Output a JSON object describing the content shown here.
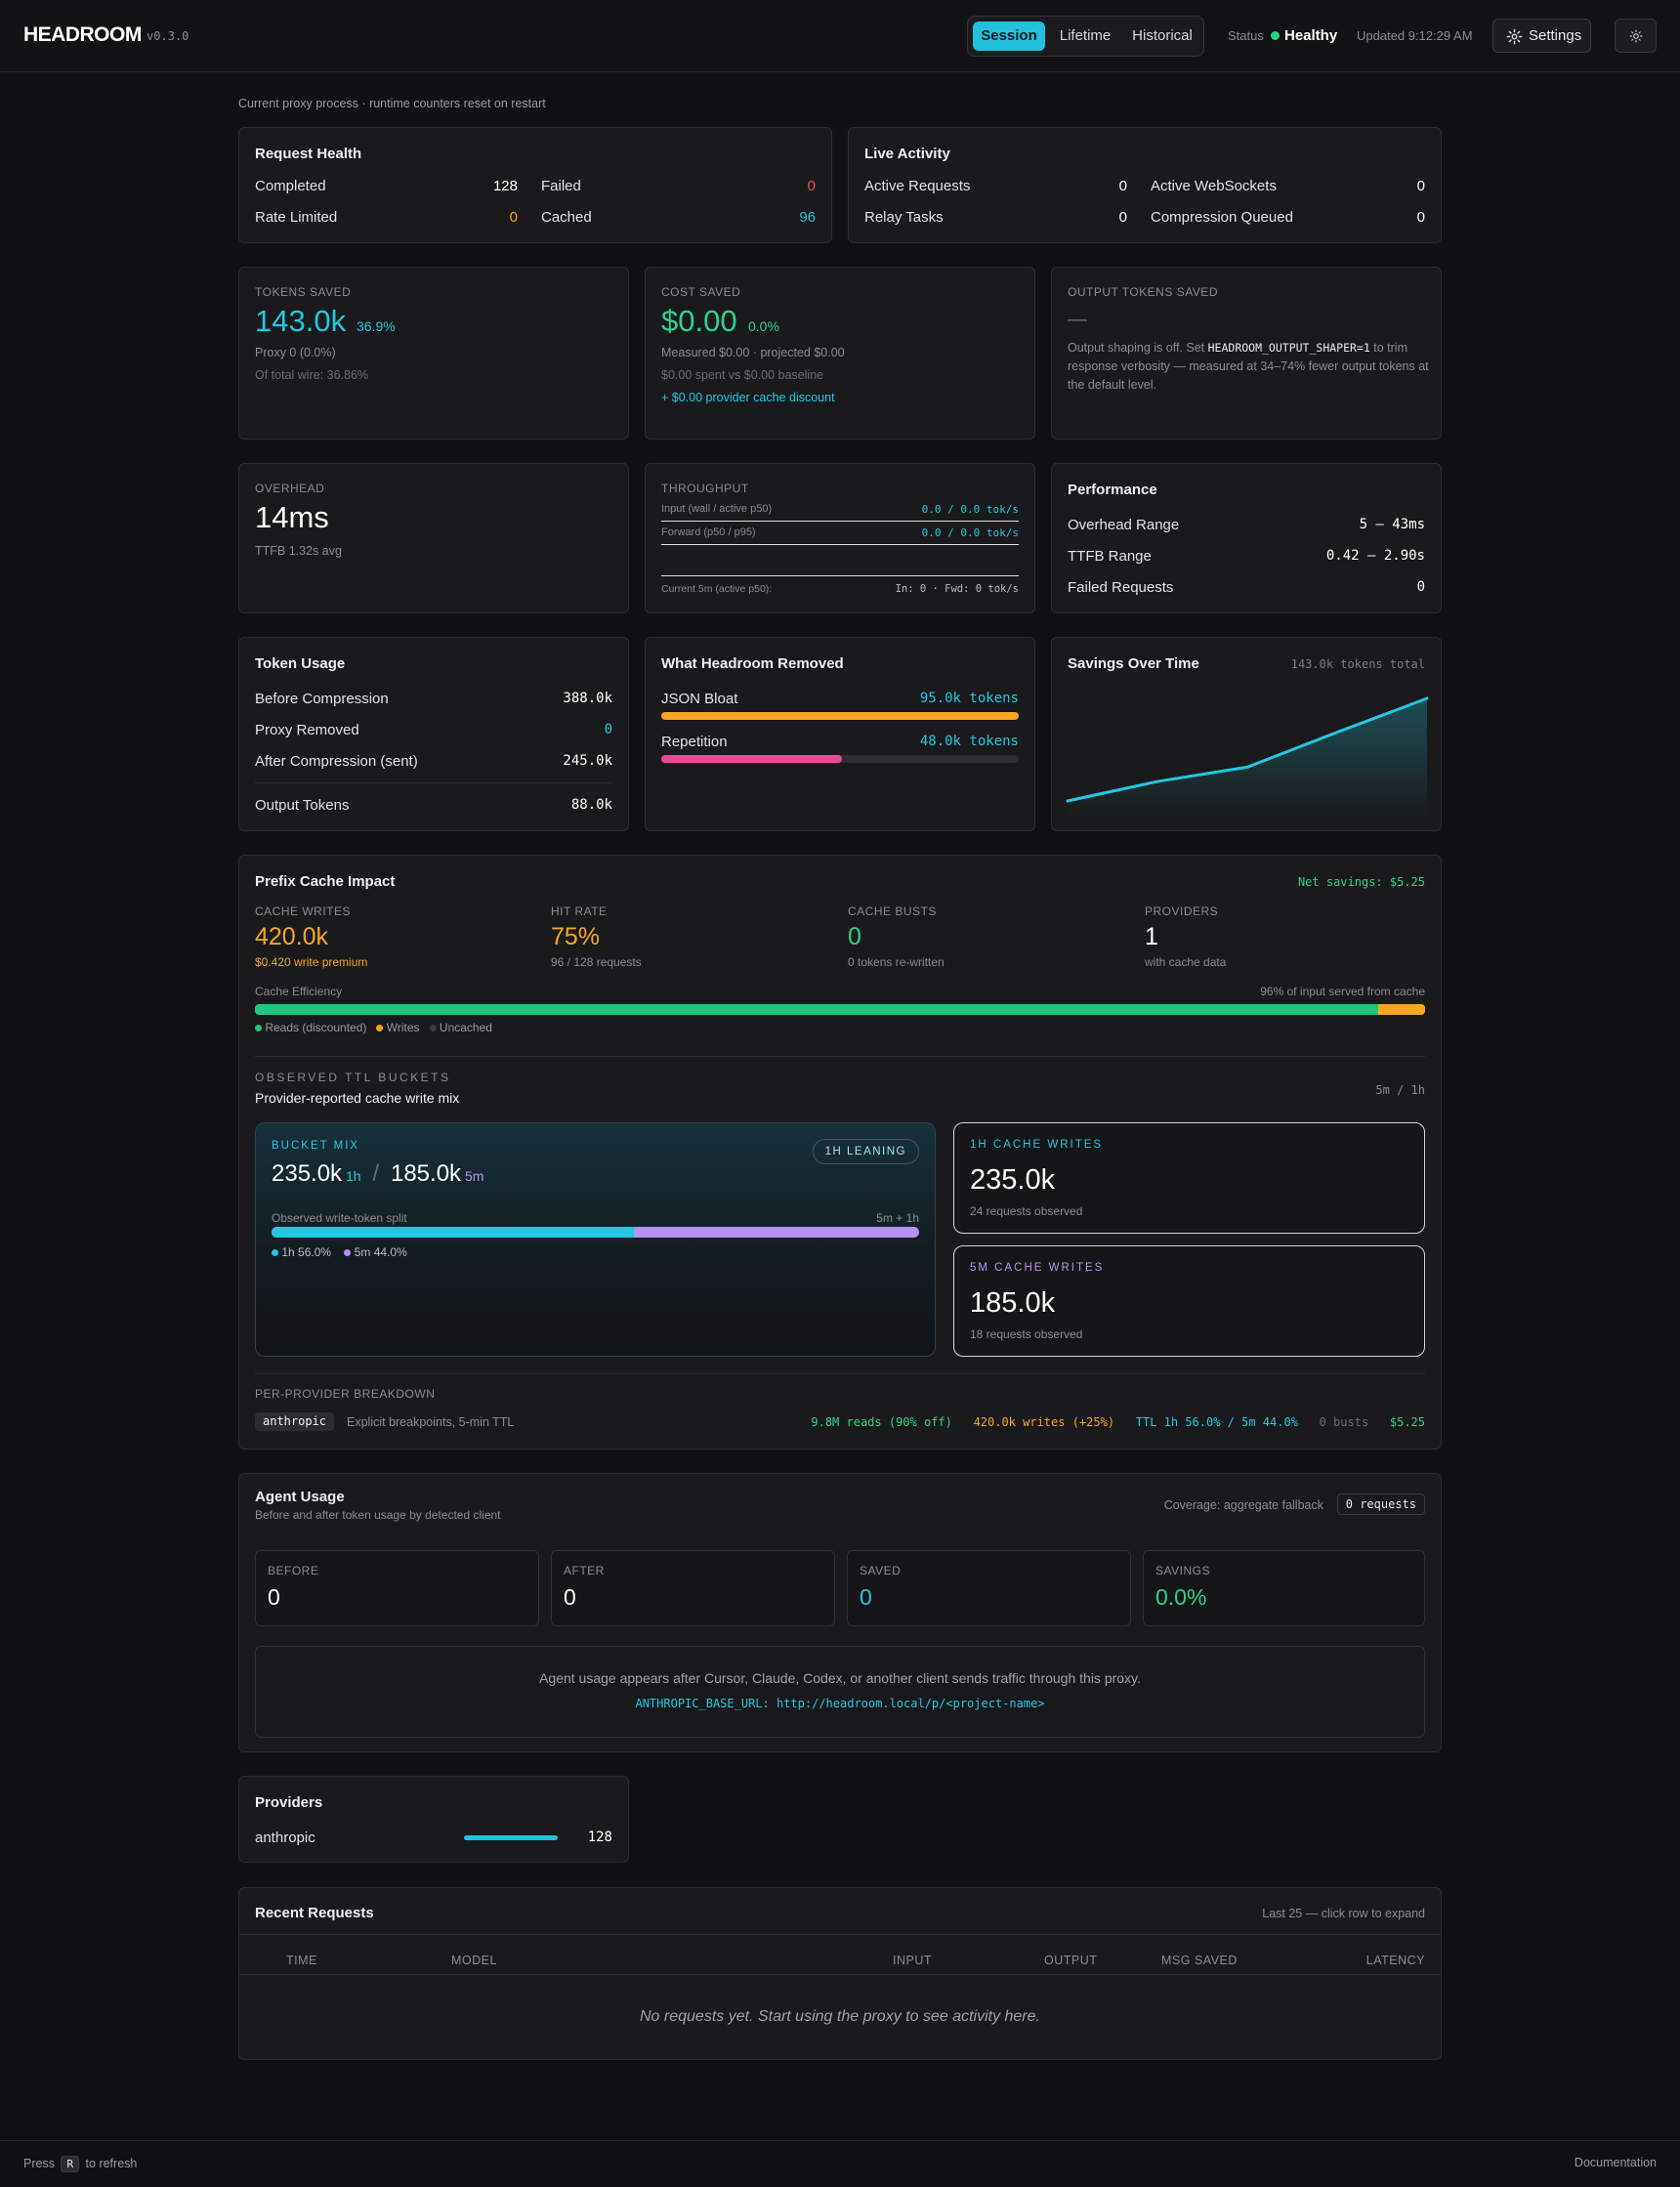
{
  "header": {
    "logo": "HEADROOM",
    "version": "v0.3.0",
    "tabs": [
      "Session",
      "Lifetime",
      "Historical"
    ],
    "active_tab": "Session",
    "status_label": "Status",
    "status_value": "Healthy",
    "updated": "Updated 9:12:29 AM",
    "settings_label": "Settings"
  },
  "subtitle": "Current proxy process · runtime counters reset on restart",
  "request_health": {
    "title": "Request Health",
    "completed_label": "Completed",
    "completed": "128",
    "failed_label": "Failed",
    "failed": "0",
    "rate_limited_label": "Rate Limited",
    "rate_limited": "0",
    "cached_label": "Cached",
    "cached": "96"
  },
  "live_activity": {
    "title": "Live Activity",
    "active_requests_label": "Active Requests",
    "active_requests": "0",
    "active_ws_label": "Active WebSockets",
    "active_ws": "0",
    "relay_label": "Relay Tasks",
    "relay": "0",
    "compression_label": "Compression Queued",
    "compression": "0"
  },
  "tokens_saved": {
    "label": "TOKENS SAVED",
    "value": "143.0k",
    "pct": "36.9%",
    "proxy": "Proxy 0 (0.0%)",
    "wire": "Of total wire: 36.86%"
  },
  "cost_saved": {
    "label": "COST SAVED",
    "value": "$0.00",
    "pct": "0.0%",
    "measured": "Measured $0.00 · projected $0.00",
    "spent": "$0.00 spent vs $0.00 baseline",
    "discount": "+ $0.00 provider cache discount"
  },
  "output_tokens": {
    "label": "OUTPUT TOKENS SAVED",
    "dash": "—",
    "text_pre": "Output shaping is off. Set ",
    "code": "HEADROOM_OUTPUT_SHAPER=1",
    "text_post": " to trim response verbosity — measured at 34–74% fewer output tokens at the default level."
  },
  "overhead": {
    "label": "OVERHEAD",
    "value": "14ms",
    "sub": "TTFB 1.32s avg"
  },
  "throughput": {
    "label": "THROUGHPUT",
    "input_label": "Input (wall / active p50)",
    "input_val": "0.0 / 0.0 tok/s",
    "forward_label": "Forward (p50 / p95)",
    "forward_val": "0.0 / 0.0 tok/s",
    "current_label": "Current 5m (active p50):",
    "current_val": "In: 0 · Fwd: 0 tok/s"
  },
  "performance": {
    "title": "Performance",
    "overhead_label": "Overhead Range",
    "overhead": "5 – 43ms",
    "ttfb_label": "TTFB Range",
    "ttfb": "0.42 – 2.90s",
    "failed_label": "Failed Requests",
    "failed": "0"
  },
  "token_usage": {
    "title": "Token Usage",
    "before_label": "Before Compression",
    "before": "388.0k",
    "proxy_label": "Proxy Removed",
    "proxy": "0",
    "after_label": "After Compression (sent)",
    "after": "245.0k",
    "output_label": "Output Tokens",
    "output": "88.0k"
  },
  "removed": {
    "title": "What Headroom Removed",
    "items": [
      {
        "label": "JSON Bloat",
        "value": "95.0k tokens",
        "fraction": 1.0,
        "color": "#f5a623"
      },
      {
        "label": "Repetition",
        "value": "48.0k tokens",
        "fraction": 0.505,
        "color": "#ec4899"
      }
    ]
  },
  "savings_chart": {
    "title": "Savings Over Time",
    "total": "143.0k tokens total"
  },
  "chart_data": {
    "type": "area",
    "series": [
      {
        "values": [
          0.0,
          0.19,
          0.33,
          0.67,
          1.0
        ]
      }
    ],
    "ylim": [
      0,
      1
    ],
    "grid": false
  },
  "cache": {
    "title": "Prefix Cache Impact",
    "net": "Net savings: $5.25",
    "writes_label": "CACHE WRITES",
    "writes": "420.0k",
    "writes_sub": "$0.420 write premium",
    "hit_label": "HIT RATE",
    "hit": "75%",
    "hit_sub": "96 / 128 requests",
    "busts_label": "CACHE BUSTS",
    "busts": "0",
    "busts_sub": "0 tokens re-written",
    "prov_label": "PROVIDERS",
    "prov": "1",
    "prov_sub": "with cache data",
    "eff_label": "Cache Efficiency",
    "eff_right": "96% of input served from cache",
    "eff_reads": 0.96,
    "eff_writes": 0.04,
    "legend_reads": "Reads (discounted)",
    "legend_writes": "Writes",
    "legend_uncached": "Uncached",
    "ttl_heading": "OBSERVED TTL BUCKETS",
    "ttl_sub": "Provider-reported cache write mix",
    "ttl_right": "5m / 1h",
    "bucket_label": "BUCKET MIX",
    "bucket_badge": "1H LEANING",
    "b1": "235.0k",
    "b1u": "1h",
    "slash": "/",
    "b2": "185.0k",
    "b2u": "5m",
    "split_label": "Observed write-token split",
    "split_right": "5m + 1h",
    "split_1h": 0.56,
    "leg_1h": "1h 56.0%",
    "leg_5m": "5m 44.0%",
    "w1h_label": "1H CACHE WRITES",
    "w1h": "235.0k",
    "w1h_sub": "24 requests observed",
    "w5m_label": "5M CACHE WRITES",
    "w5m": "185.0k",
    "w5m_sub": "18 requests observed",
    "per_label": "PER-PROVIDER BREAKDOWN",
    "prov_tag": "anthropic",
    "prov_desc": "Explicit breakpoints, 5-min TTL",
    "reads": "9.8M reads (90% off)",
    "pwrites": "420.0k writes (+25%)",
    "ttl": "TTL 1h 56.0% / 5m 44.0%",
    "pbusts": "0 busts",
    "psav": "$5.25"
  },
  "agent": {
    "title": "Agent Usage",
    "sub": "Before and after token usage by detected client",
    "coverage": "Coverage: aggregate fallback",
    "reqs": "0 requests",
    "before_label": "BEFORE",
    "before": "0",
    "after_label": "AFTER",
    "after": "0",
    "saved_label": "SAVED",
    "saved": "0",
    "savings_label": "SAVINGS",
    "savings": "0.0%",
    "empty": "Agent usage appears after Cursor, Claude, Codex, or another client sends traffic through this proxy.",
    "env": "ANTHROPIC_BASE_URL: http://headroom.local/p/<project-name>"
  },
  "providers": {
    "title": "Providers",
    "name": "anthropic",
    "count": "128",
    "fraction": 1.0
  },
  "recent": {
    "title": "Recent Requests",
    "hint": "Last 25 — click row to expand",
    "cols": [
      "TIME",
      "MODEL",
      "INPUT",
      "OUTPUT",
      "MSG SAVED",
      "LATENCY"
    ],
    "empty": "No requests yet. Start using the proxy to see activity here."
  },
  "footer": {
    "press": "Press",
    "key": "R",
    "refresh": "to refresh",
    "docs": "Documentation"
  },
  "colors": {
    "accent": "#22c0dc",
    "green": "#2dd28b",
    "orange": "#f5a623",
    "pink": "#ec4899",
    "purple": "#b591f5",
    "red": "#ef5350"
  }
}
